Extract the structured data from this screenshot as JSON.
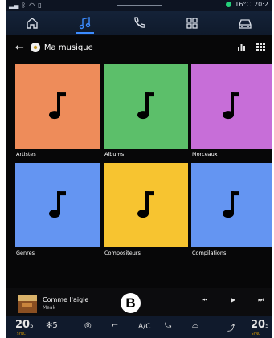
{
  "status": {
    "temperature": "16°C",
    "time": "20:2",
    "colors": {
      "indicator": "#24d07a"
    }
  },
  "nav": {
    "items": [
      {
        "name": "home-icon",
        "active": false
      },
      {
        "name": "music-icon",
        "active": true
      },
      {
        "name": "phone-icon",
        "active": false
      },
      {
        "name": "apps-icon",
        "active": false
      },
      {
        "name": "car-icon",
        "active": false
      }
    ]
  },
  "header": {
    "title": "Ma musique"
  },
  "categories": [
    {
      "label": "Artistes",
      "color": "#ee8c5a"
    },
    {
      "label": "Albums",
      "color": "#5cbf6a"
    },
    {
      "label": "Morceaux",
      "color": "#c76ed8"
    },
    {
      "label": "Genres",
      "color": "#6495f2"
    },
    {
      "label": "Compositeurs",
      "color": "#f7c430"
    },
    {
      "label": "Compilations",
      "color": "#6495f2"
    }
  ],
  "now_playing": {
    "title": "Comme l'aigle",
    "artist": "Meak",
    "badge": "B"
  },
  "climate": {
    "left_temp": "20",
    "left_temp_decimal": "5",
    "fan_level": "5",
    "ac_label": "A/C",
    "right_temp": "20",
    "right_temp_decimal": "5",
    "sync_label": "SYNC"
  }
}
